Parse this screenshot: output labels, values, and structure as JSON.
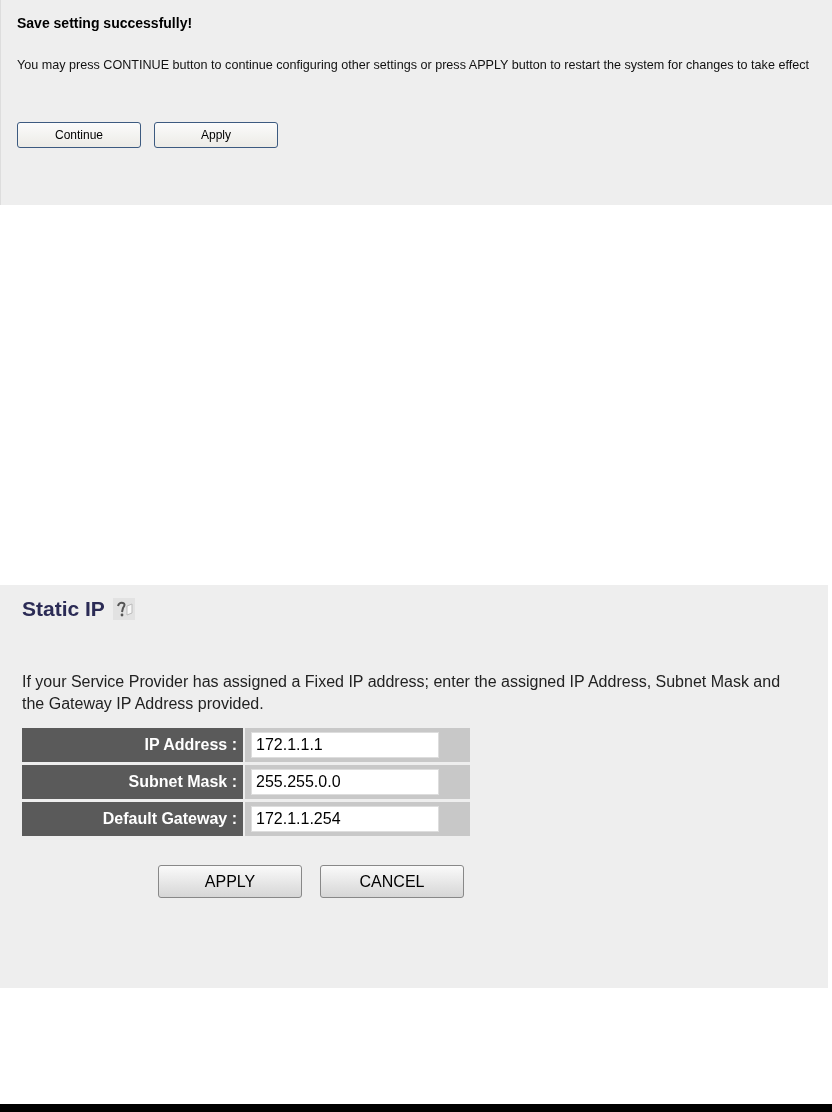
{
  "save_panel": {
    "title": "Save setting successfully!",
    "message": "You may press CONTINUE button to continue configuring other settings or press APPLY button to restart the system for changes to take effect",
    "buttons": [
      "Continue",
      "Apply"
    ]
  },
  "static_ip_panel": {
    "title": "Static IP",
    "description": "If your Service Provider has assigned a Fixed IP address; enter the assigned IP Address, Subnet Mask and the Gateway IP Address provided.",
    "fields": [
      {
        "label": "IP Address :",
        "value": "172.1.1.1"
      },
      {
        "label": "Subnet Mask :",
        "value": "255.255.0.0"
      },
      {
        "label": "Default Gateway :",
        "value": "172.1.1.254"
      }
    ],
    "buttons": [
      "APPLY",
      "CANCEL"
    ]
  }
}
